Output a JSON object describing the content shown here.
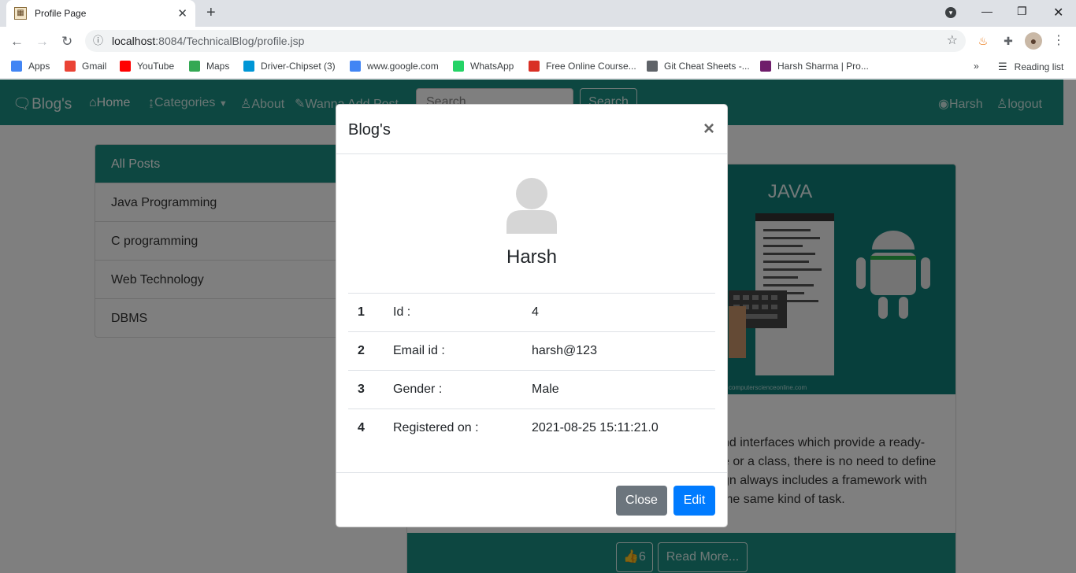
{
  "browser": {
    "tab_title": "Profile Page",
    "url_host": "localhost",
    "url_rest": ":8084/TechnicalBlog/profile.jsp",
    "bookmarks": [
      {
        "label": "Apps",
        "color": "#4285f4"
      },
      {
        "label": "Gmail",
        "color": "#ea4335"
      },
      {
        "label": "YouTube",
        "color": "#ff0000"
      },
      {
        "label": "Maps",
        "color": "#34a853"
      },
      {
        "label": "Driver-Chipset (3)",
        "color": "#0096d6"
      },
      {
        "label": "www.google.com",
        "color": "#4285f4"
      },
      {
        "label": "WhatsApp",
        "color": "#25d366"
      },
      {
        "label": "Free Online Course...",
        "color": "#d93025"
      },
      {
        "label": "Git Cheat Sheets -...",
        "color": "#5f6368"
      },
      {
        "label": "Harsh Sharma | Pro...",
        "color": "#6f1d6b"
      }
    ],
    "reading_list": "Reading list"
  },
  "navbar": {
    "brand": "Blog's",
    "home": "Home",
    "categories": "Categories",
    "about": "About",
    "post": "Wanna Add Post",
    "search_placeholder": "Search",
    "search_button": "Search",
    "user": "Harsh",
    "logout": "logout"
  },
  "categories": [
    {
      "label": "All Posts"
    },
    {
      "label": "Java Programming"
    },
    {
      "label": "C programming"
    },
    {
      "label": "Web Technology"
    },
    {
      "label": "DBMS"
    }
  ],
  "post": {
    "image_title": "JAVA",
    "image_credit": "computerscienceonline.com",
    "text_lines": [
      "nd interfaces which provide a ready-",
      "e or a class, there is no need to define",
      "gn always includes a framework with",
      "the same kind of task."
    ],
    "likes": "6",
    "read_more": "Read More..."
  },
  "modal": {
    "title": "Blog's",
    "close_x": "×",
    "user_name": "Harsh",
    "rows": [
      {
        "n": "1",
        "key": "Id :",
        "value": "4"
      },
      {
        "n": "2",
        "key": "Email id :",
        "value": "harsh@123"
      },
      {
        "n": "3",
        "key": "Gender :",
        "value": "Male"
      },
      {
        "n": "4",
        "key": "Registered on :",
        "value": "2021-08-25 15:11:21.0"
      }
    ],
    "close_button": "Close",
    "edit_button": "Edit"
  },
  "colors": {
    "primary": "#1a8f83",
    "edit": "#007bff",
    "close": "#6c757d"
  }
}
